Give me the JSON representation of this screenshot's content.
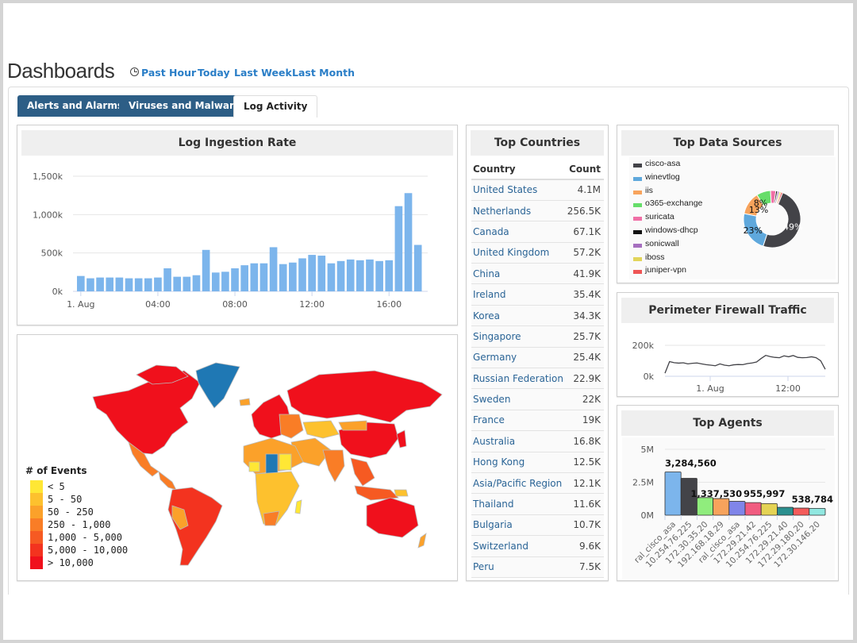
{
  "header": {
    "title": "Dashboards",
    "clock_icon": "clock-icon",
    "ranges": [
      "Past Hour",
      "Today",
      "Last Week",
      "Last Month"
    ]
  },
  "tabs": [
    {
      "label": "Alerts and Alarms",
      "active": false
    },
    {
      "label": "Viruses and Malware",
      "active": false
    },
    {
      "label": "Log Activity",
      "active": true
    }
  ],
  "colors": {
    "tab_dark": "#2d5e86",
    "link": "#2a7ec7",
    "bar": "#7cb5ec"
  },
  "chart_data": [
    {
      "id": "log_ingestion",
      "type": "bar",
      "title": "Log Ingestion Rate",
      "xlabel": "",
      "ylabel": "",
      "ylim": [
        0,
        1500000
      ],
      "yticks": [
        "0k",
        "500k",
        "1,000k",
        "1,500k"
      ],
      "xticks": [
        "1. Aug",
        "04:00",
        "08:00",
        "12:00",
        "16:00"
      ],
      "interval": "30 min",
      "values": [
        200000,
        170000,
        180000,
        180000,
        180000,
        170000,
        170000,
        170000,
        180000,
        300000,
        190000,
        190000,
        210000,
        540000,
        245000,
        255000,
        300000,
        340000,
        365000,
        365000,
        575000,
        355000,
        375000,
        430000,
        475000,
        465000,
        365000,
        395000,
        415000,
        405000,
        415000,
        395000,
        405000,
        1110000,
        1280000,
        605000
      ]
    },
    {
      "id": "events_map",
      "type": "heatmap",
      "title": "# of Events",
      "legend": [
        {
          "label": "< 5",
          "color": "#ffe735"
        },
        {
          "label": "5 - 50",
          "color": "#fdc12e"
        },
        {
          "label": "50 - 250",
          "color": "#fba12a"
        },
        {
          "label": "250 - 1,000",
          "color": "#f97d26"
        },
        {
          "label": "1,000 - 5,000",
          "color": "#f65a22"
        },
        {
          "label": "5,000 - 10,000",
          "color": "#f3331f"
        },
        {
          "label": "> 10,000",
          "color": "#f0101c"
        }
      ],
      "no_data_color": "#1f78b4",
      "legend_position": "bottom-left"
    },
    {
      "id": "top_countries",
      "type": "table",
      "title": "Top Countries",
      "columns": [
        "Country",
        "Count"
      ],
      "rows": [
        [
          "United States",
          "4.1M"
        ],
        [
          "Netherlands",
          "256.5K"
        ],
        [
          "Canada",
          "67.1K"
        ],
        [
          "United Kingdom",
          "57.2K"
        ],
        [
          "China",
          "41.9K"
        ],
        [
          "Ireland",
          "35.4K"
        ],
        [
          "Korea",
          "34.3K"
        ],
        [
          "Singapore",
          "25.7K"
        ],
        [
          "Germany",
          "25.4K"
        ],
        [
          "Russian Federation",
          "22.9K"
        ],
        [
          "Sweden",
          "22K"
        ],
        [
          "France",
          "19K"
        ],
        [
          "Australia",
          "16.8K"
        ],
        [
          "Hong Kong",
          "12.5K"
        ],
        [
          "Asia/Pacific Region",
          "12.1K"
        ],
        [
          "Thailand",
          "11.6K"
        ],
        [
          "Bulgaria",
          "10.7K"
        ],
        [
          "Switzerland",
          "9.6K"
        ],
        [
          "Peru",
          "7.5K"
        ]
      ]
    },
    {
      "id": "top_data_sources",
      "type": "pie",
      "title": "Top Data Sources",
      "legend_position": "left",
      "slices": [
        {
          "name": "cisco-asa",
          "value": 49,
          "color": "#434348",
          "label": "49%"
        },
        {
          "name": "winevtlog",
          "value": 23,
          "color": "#5fa8dc",
          "label": "23%"
        },
        {
          "name": "iis",
          "value": 13,
          "color": "#f7a35c",
          "label": "13%"
        },
        {
          "name": "o365-exchange",
          "value": 8,
          "color": "#66dd6a",
          "label": "8%"
        },
        {
          "name": "suricata",
          "value": 3,
          "color": "#f06fa6",
          "label": ""
        },
        {
          "name": "windows-dhcp",
          "value": 1,
          "color": "#111111",
          "label": ""
        },
        {
          "name": "sonicwall",
          "value": 1,
          "color": "#a66fbf",
          "label": ""
        },
        {
          "name": "iboss",
          "value": 1,
          "color": "#e2d55a",
          "label": ""
        },
        {
          "name": "juniper-vpn",
          "value": 1,
          "color": "#ee5555",
          "label": ""
        }
      ]
    },
    {
      "id": "perimeter_firewall",
      "type": "line",
      "title": "Perimeter Firewall Traffic",
      "ylim": [
        0,
        200000
      ],
      "yticks": [
        "0k",
        "200k"
      ],
      "xticks": [
        "1. Aug",
        "12:00"
      ],
      "values": [
        20000,
        95000,
        88000,
        85000,
        87000,
        80000,
        84000,
        86000,
        80000,
        75000,
        72000,
        68000,
        80000,
        72000,
        68000,
        74000,
        76000,
        75000,
        82000,
        86000,
        92000,
        115000,
        135000,
        127000,
        122000,
        120000,
        132000,
        126000,
        134000,
        122000,
        120000,
        121000,
        126000,
        120000,
        100000,
        45000
      ]
    },
    {
      "id": "top_agents",
      "type": "bar",
      "title": "Top Agents",
      "ylim": [
        0,
        5000000
      ],
      "yticks": [
        "0M",
        "2.5M",
        "5M"
      ],
      "categories": [
        "ral_cisco_asa",
        "10.254.76.225",
        "172.30.35.20",
        "192.168.18.29",
        "ral_cisco_asa",
        "172.29.21.42",
        "10.254.76.225",
        "172.29.21.40",
        "172.29.180.20",
        "172.30.146.20"
      ],
      "values": [
        3284560,
        2800000,
        1337530,
        1260000,
        1050000,
        955997,
        880000,
        600000,
        538784,
        520000
      ],
      "data_labels": [
        "3,284,560",
        "",
        "1,337,530",
        "",
        "",
        "955,997",
        "",
        "",
        "538,784",
        ""
      ],
      "colors": [
        "#7cb5ec",
        "#434348",
        "#90ed7d",
        "#f7a35c",
        "#8085e9",
        "#f15c80",
        "#e4d354",
        "#2b908f",
        "#f45b5b",
        "#91e8e1"
      ]
    }
  ]
}
